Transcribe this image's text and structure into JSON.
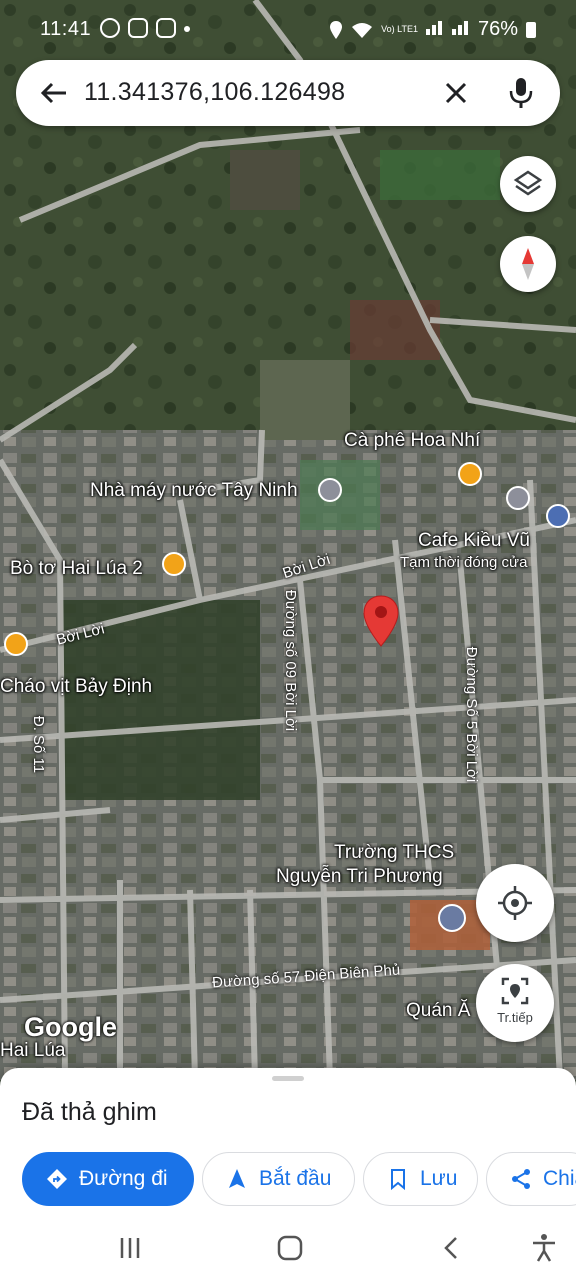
{
  "status_bar": {
    "time": "11:41",
    "battery": "76%",
    "network": "Vo) LTE1"
  },
  "search": {
    "query": "11.341376,106.126498"
  },
  "map": {
    "places": [
      {
        "name": "Cà phê Hoa Nhí"
      },
      {
        "name": "Nhà máy nước Tây Ninh"
      },
      {
        "name": "Cafe Kiều Vũ"
      },
      {
        "name": "Tạm thời đóng cửa"
      },
      {
        "name": "Bò tơ Hai Lúa 2"
      },
      {
        "name": "Cháo vịt Bảy Định"
      },
      {
        "name": "Trường THCS"
      },
      {
        "name": "Nguyễn Tri Phương"
      },
      {
        "name": "Quán Ă"
      },
      {
        "name": "Hai Lúa"
      }
    ],
    "roads": [
      {
        "name": "Bời Lời"
      },
      {
        "name": "Bời Lời"
      },
      {
        "name": "Đường số 09 Bời Lời"
      },
      {
        "name": "Đường Số 5 Bời Lời"
      },
      {
        "name": "Đ. Số 11"
      },
      {
        "name": "Đường số 57 Điện Biên Phủ"
      }
    ],
    "attribution": "Google",
    "live_view_label": "Tr.tiếp",
    "colors": {
      "pin": "#e53935",
      "poi_food": "#f2a318",
      "poi_gov": "#8d8f9a",
      "poi_school": "#6a7ba2"
    }
  },
  "sheet": {
    "title": "Đã thả ghim",
    "actions": [
      {
        "label": "Đường đi",
        "icon": "directions-icon"
      },
      {
        "label": "Bắt đầu",
        "icon": "navigate-arrow-icon"
      },
      {
        "label": "Lưu",
        "icon": "bookmark-icon"
      },
      {
        "label": "Chia",
        "icon": "share-icon"
      }
    ]
  },
  "accent": "#1a73e8"
}
